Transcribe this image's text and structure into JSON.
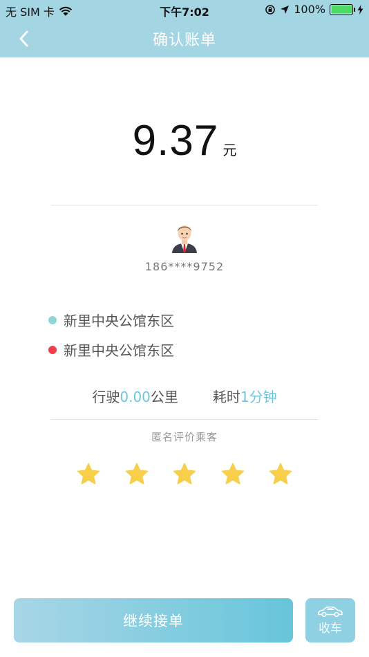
{
  "status_bar": {
    "carrier": "无 SIM 卡",
    "time": "下午7:02",
    "battery": "100%"
  },
  "nav": {
    "title": "确认账单"
  },
  "bill": {
    "amount": "9.37",
    "unit": "元"
  },
  "passenger": {
    "phone": "186****9752"
  },
  "route": {
    "start": "新里中央公馆东区",
    "end": "新里中央公馆东区"
  },
  "stats": {
    "distance_prefix": "行驶",
    "distance_value": "0.00",
    "distance_unit": "公里",
    "duration_prefix": "耗时",
    "duration_value": "1分钟"
  },
  "rating": {
    "label": "匿名评价乘客",
    "stars_filled": 5,
    "stars_total": 5
  },
  "actions": {
    "continue_label": "继续接单",
    "park_label": "收车"
  },
  "colors": {
    "header": "#a3d5e3",
    "accent": "#6cc7de",
    "start_dot": "#8fd6d8",
    "end_dot": "#ee3f4a",
    "star": "#f7cf4b"
  }
}
